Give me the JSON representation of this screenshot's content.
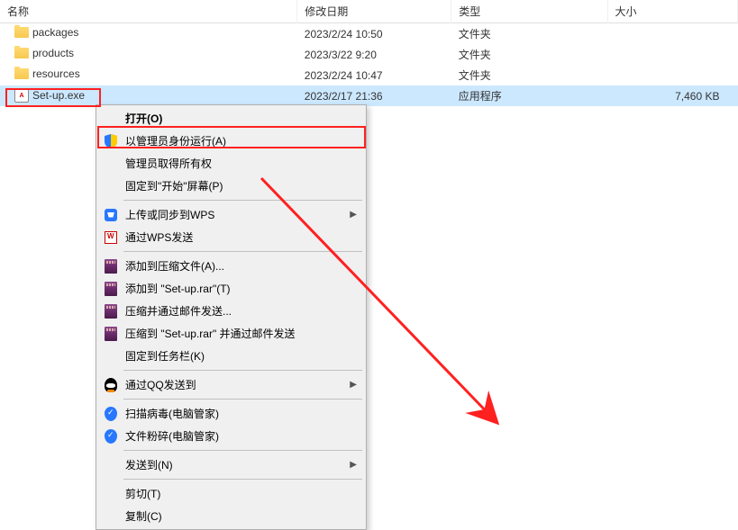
{
  "columns": {
    "name": "名称",
    "date": "修改日期",
    "type": "类型",
    "size": "大小"
  },
  "files": [
    {
      "name": "packages",
      "date": "2023/2/24 10:50",
      "type": "文件夹",
      "size": "",
      "icon": "folder"
    },
    {
      "name": "products",
      "date": "2023/3/22 9:20",
      "type": "文件夹",
      "size": "",
      "icon": "folder"
    },
    {
      "name": "resources",
      "date": "2023/2/24 10:47",
      "type": "文件夹",
      "size": "",
      "icon": "folder"
    },
    {
      "name": "Set-up.exe",
      "date": "2023/2/17 21:36",
      "type": "应用程序",
      "size": "7,460 KB",
      "icon": "exe",
      "selected": true
    }
  ],
  "menu": {
    "open": "打开(O)",
    "run_as_admin": "以管理员身份运行(A)",
    "admin_take_ownership": "管理员取得所有权",
    "pin_start": "固定到\"开始\"屏幕(P)",
    "upload_wps": "上传或同步到WPS",
    "send_wps": "通过WPS发送",
    "add_archive": "添加到压缩文件(A)...",
    "add_setup_rar": "添加到 \"Set-up.rar\"(T)",
    "compress_email": "压缩并通过邮件发送...",
    "compress_setup_email": "压缩到 \"Set-up.rar\" 并通过邮件发送",
    "pin_taskbar": "固定到任务栏(K)",
    "send_qq": "通过QQ发送到",
    "scan_virus": "扫描病毒(电脑管家)",
    "shred_file": "文件粉碎(电脑管家)",
    "send_to": "发送到(N)",
    "cut": "剪切(T)",
    "copy": "复制(C)"
  },
  "exe_badge": "A"
}
